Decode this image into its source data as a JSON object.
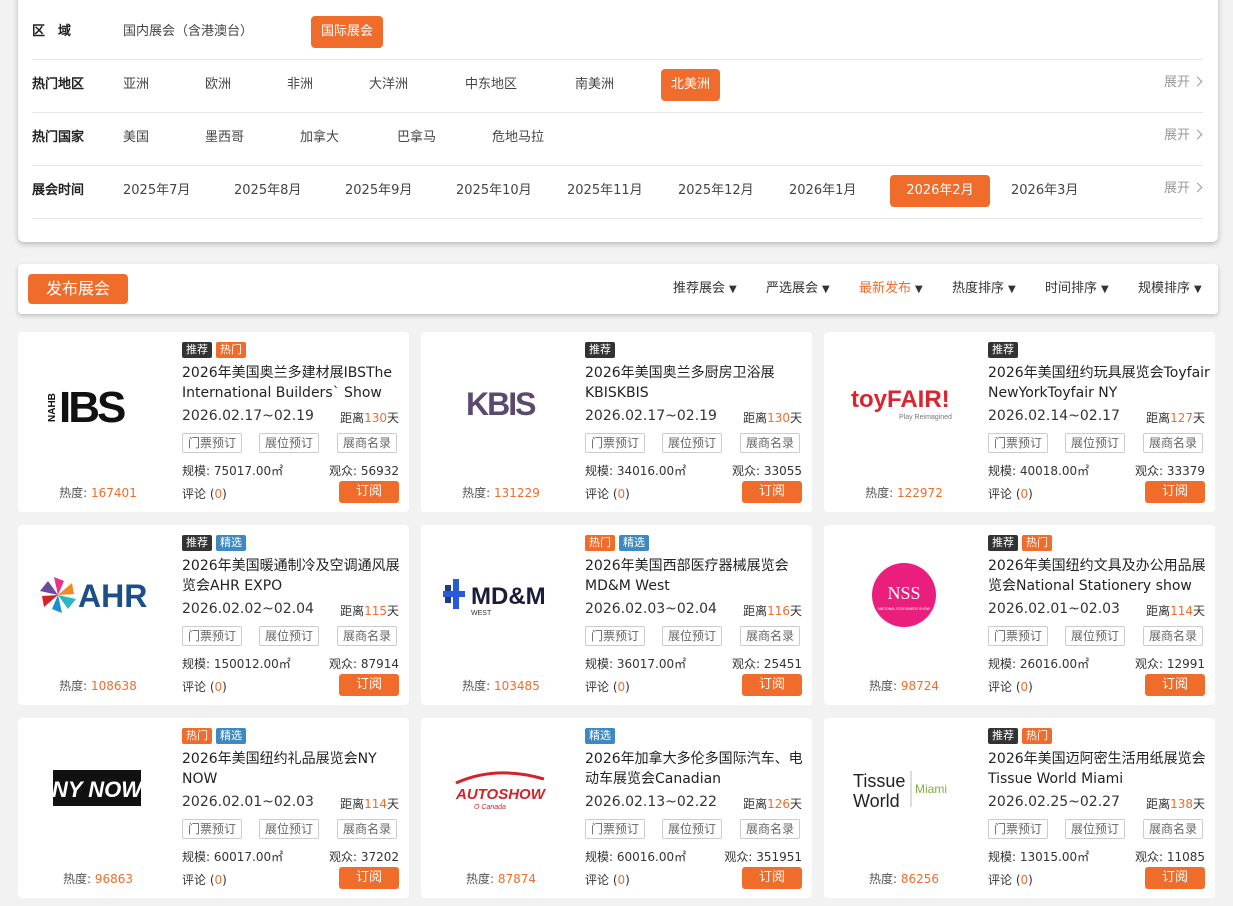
{
  "filters": {
    "region": {
      "label": "区　域",
      "options": [
        "国内展会（含港澳台）",
        "国际展会"
      ],
      "active": "国际展会"
    },
    "hot_area": {
      "label": "热门地区",
      "options": [
        "亚洲",
        "欧洲",
        "非洲",
        "大洋洲",
        "中东地区",
        "南美洲",
        "北美洲"
      ],
      "active": "北美洲",
      "expand": "展开"
    },
    "hot_country": {
      "label": "热门国家",
      "options": [
        "美国",
        "墨西哥",
        "加拿大",
        "巴拿马",
        "危地马拉"
      ],
      "expand": "展开"
    },
    "time": {
      "label": "展会时间",
      "options": [
        "2025年7月",
        "2025年8月",
        "2025年9月",
        "2025年10月",
        "2025年11月",
        "2025年12月",
        "2026年1月",
        "2026年2月",
        "2026年3月"
      ],
      "active": "2026年2月",
      "expand": "展开"
    }
  },
  "toolbar": {
    "publish_label": "发布展会",
    "sorts": [
      "推荐展会",
      "严选展会",
      "最新发布",
      "热度排序",
      "时间排序",
      "规模排序"
    ],
    "active_sort": "最新发布"
  },
  "card_labels": {
    "tickets": "门票预订",
    "booth": "展位预订",
    "exhibitors": "展商名录",
    "subscribe": "订阅",
    "heat_prefix": "热度: ",
    "distance_prefix": "距离",
    "distance_suffix": "天",
    "scale_prefix": "规模: ",
    "audience_prefix": "观众: ",
    "comments_prefix": "评论 (",
    "comments_suffix": ")"
  },
  "tag_colors": {
    "推荐": "#333333",
    "热门": "#ef6c2b",
    "精选": "#3f89c1"
  },
  "colors": {
    "accent": "#ef6c2b"
  },
  "cards": [
    {
      "tags": [
        "推荐",
        "热门"
      ],
      "title": "2026年美国奥兰多建材展IBSThe International Builders` Show",
      "date": "2026.02.17~02.19",
      "distance": "130",
      "scale": "75017.00㎡",
      "audience": "56932",
      "heat": "167401",
      "comments": "0",
      "logo": "nahb-ibs-logo",
      "logo_text": "IBS",
      "logo_sub": "NAHB"
    },
    {
      "tags": [
        "推荐"
      ],
      "title": "2026年美国奥兰多厨房卫浴展KBISKBIS",
      "date": "2026.02.17~02.19",
      "distance": "130",
      "scale": "34016.00㎡",
      "audience": "33055",
      "heat": "131229",
      "comments": "0",
      "logo": "kbis-logo",
      "logo_text": "KBIS"
    },
    {
      "tags": [
        "推荐"
      ],
      "title": "2026年美国纽约玩具展览会Toyfair NewYorkToyfair NY",
      "date": "2026.02.14~02.17",
      "distance": "127",
      "scale": "40018.00㎡",
      "audience": "33379",
      "heat": "122972",
      "comments": "0",
      "logo": "toyfair-logo",
      "logo_text": "toyFAIR!",
      "logo_sub": "Play Reimagined"
    },
    {
      "tags": [
        "推荐",
        "精选"
      ],
      "title": "2026年美国暖通制冷及空调通风展览会AHR EXPO",
      "date": "2026.02.02~02.04",
      "distance": "115",
      "scale": "150012.00㎡",
      "audience": "87914",
      "heat": "108638",
      "comments": "0",
      "logo": "ahr-logo",
      "logo_text": "AHR"
    },
    {
      "tags": [
        "热门",
        "精选"
      ],
      "title": "2026年美国西部医疗器械展览会MD&M West",
      "date": "2026.02.03~02.04",
      "distance": "116",
      "scale": "36017.00㎡",
      "audience": "25451",
      "heat": "103485",
      "comments": "0",
      "logo": "mdm-logo",
      "logo_text": "MD&M",
      "logo_sub": "WEST"
    },
    {
      "tags": [
        "推荐",
        "热门"
      ],
      "title": "2026年美国纽约文具及办公用品展览会National Stationery show",
      "date": "2026.02.01~02.03",
      "distance": "114",
      "scale": "26016.00㎡",
      "audience": "12991",
      "heat": "98724",
      "comments": "0",
      "logo": "nss-logo",
      "logo_text": "NSS",
      "logo_sub": "NATIONAL STATIONERY SHOW"
    },
    {
      "tags": [
        "热门",
        "精选"
      ],
      "title": "2026年美国纽约礼品展览会NY NOW",
      "date": "2026.02.01~02.03",
      "distance": "114",
      "scale": "60017.00㎡",
      "audience": "37202",
      "heat": "96863",
      "comments": "0",
      "logo": "nynow-logo",
      "logo_text": "NY NOW"
    },
    {
      "tags": [
        "精选"
      ],
      "title": "2026年加拿大多伦多国际汽车、电动车展览会Canadian",
      "date": "2026.02.13~02.22",
      "distance": "126",
      "scale": "60016.00㎡",
      "audience": "351951",
      "heat": "87874",
      "comments": "0",
      "logo": "autoshow-logo",
      "logo_text": "AUTOSHOW",
      "logo_sub": "O Canada"
    },
    {
      "tags": [
        "推荐",
        "热门"
      ],
      "title": "2026年美国迈阿密生活用纸展览会Tissue World Miami",
      "date": "2026.02.25~02.27",
      "distance": "138",
      "scale": "13015.00㎡",
      "audience": "11085",
      "heat": "86256",
      "comments": "0",
      "logo": "tissue-world-logo",
      "logo_text": "Tissue World",
      "logo_sub": "Miami"
    }
  ]
}
